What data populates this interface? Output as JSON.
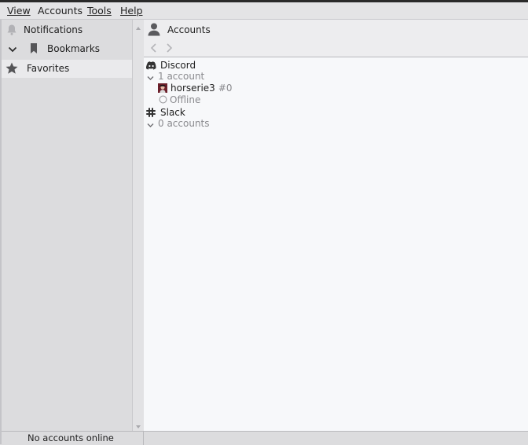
{
  "menubar": {
    "view_label": "View",
    "accounts_label": "Accounts",
    "tools_label": "Tools",
    "help_label": "Help"
  },
  "sidebar": {
    "items": [
      {
        "label": "Notifications",
        "icon": "bell-icon"
      },
      {
        "label": "Bookmarks",
        "icon": "bookmark-icon"
      },
      {
        "label": "Favorites",
        "icon": "star-icon"
      }
    ]
  },
  "header": {
    "title": "Accounts",
    "icon": "person-icon"
  },
  "services": [
    {
      "name": "Discord",
      "count_label": "1 account",
      "icon": "discord-icon"
    },
    {
      "name": "Slack",
      "count_label": "0 accounts",
      "icon": "slack-icon"
    }
  ],
  "account": {
    "username": "horserie3",
    "discriminator": "#0",
    "status": "Offline"
  },
  "statusbar": {
    "text": "No accounts online"
  },
  "colors": {
    "background": "#dcdcde",
    "panel": "#f7f8fa",
    "muted_text": "#8a8a8e"
  }
}
